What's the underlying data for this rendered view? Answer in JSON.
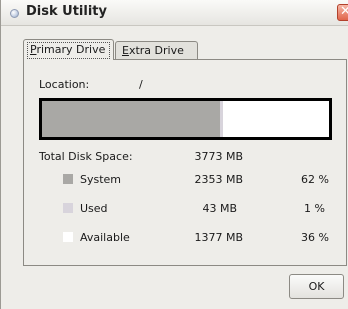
{
  "window": {
    "title": "Disk Utility",
    "close_label": "✕"
  },
  "tabs": [
    {
      "label_prefix": "",
      "accel": "P",
      "label_rest": "rimary Drive",
      "selected": true
    },
    {
      "label_prefix": "",
      "accel": "E",
      "label_rest": "xtra Drive",
      "selected": false
    }
  ],
  "location": {
    "label": "Location:",
    "value": "/"
  },
  "usage_bar": {
    "system_fraction": 0.62,
    "used_fraction": 0.01,
    "available_fraction": 0.36,
    "colors": {
      "system": "#a9a8a5",
      "used": "#d8d4dc",
      "available": "#ffffff",
      "border": "#000000"
    }
  },
  "total": {
    "label": "Total Disk Space:",
    "size": "3773 MB"
  },
  "rows": [
    {
      "name": "System",
      "size": "2353 MB",
      "percent": "62 %",
      "swatch_color": "#a9a8a5"
    },
    {
      "name": "Used",
      "size": "43 MB",
      "percent": "1 %",
      "swatch_color": "#d8d4dc"
    },
    {
      "name": "Available",
      "size": "1377 MB",
      "percent": "36 %",
      "swatch_color": "#ffffff"
    }
  ],
  "buttons": {
    "ok_label": "OK"
  }
}
